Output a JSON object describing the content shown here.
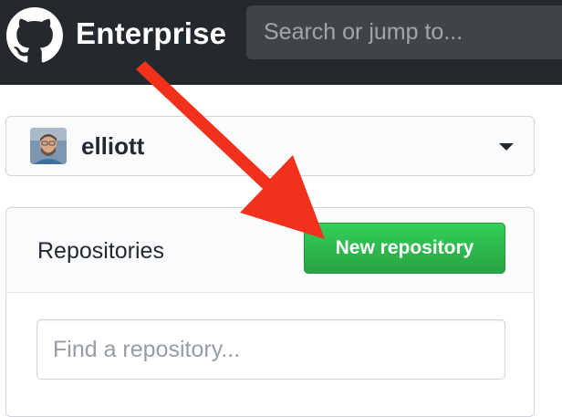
{
  "header": {
    "brand": "Enterprise",
    "search_placeholder": "Search or jump to..."
  },
  "switcher": {
    "username": "elliott"
  },
  "repositories": {
    "title": "Repositories",
    "new_button_label": "New repository",
    "find_placeholder": "Find a repository..."
  },
  "colors": {
    "header_bg": "#24292e",
    "button_green": "#2ea44f",
    "annotation_arrow": "#f2311d"
  },
  "icons": {
    "logo": "github-octocat-icon",
    "caret": "caret-down-icon",
    "annotation": "red-arrow-annotation"
  }
}
